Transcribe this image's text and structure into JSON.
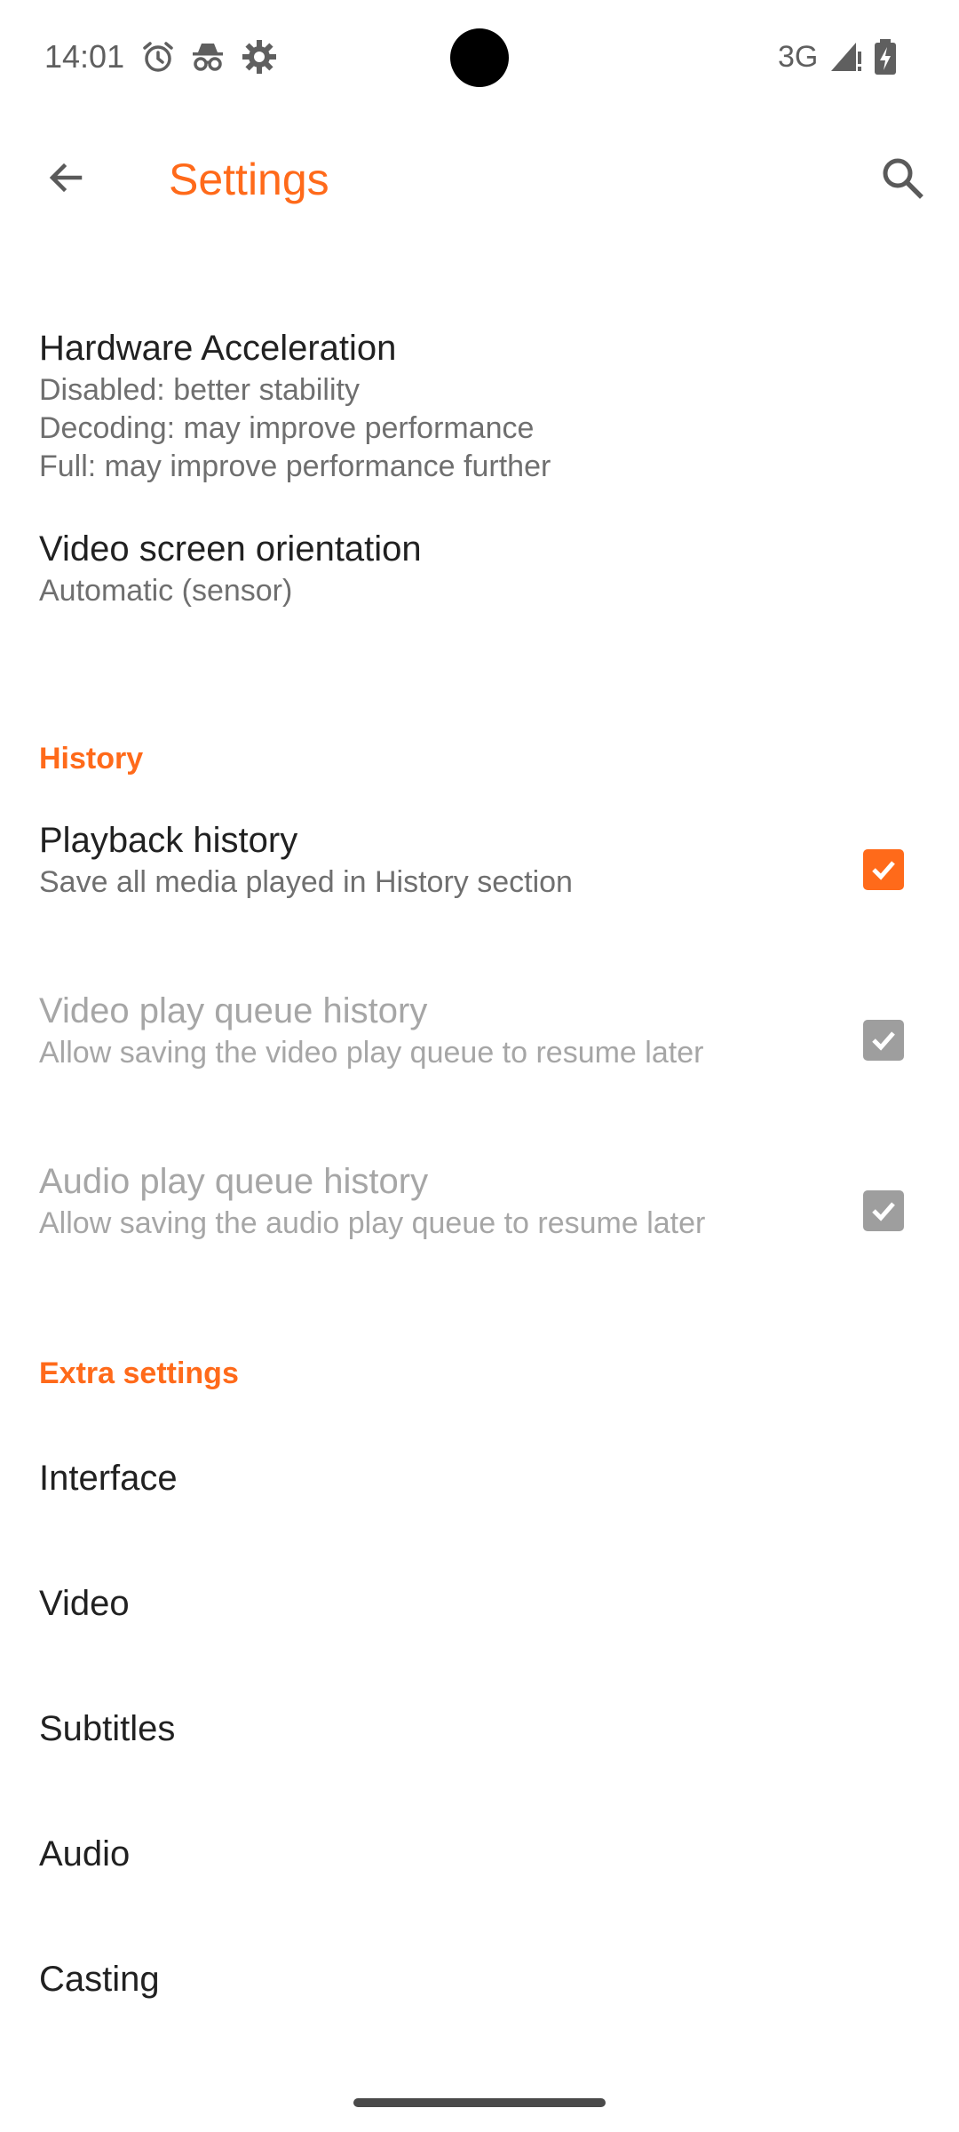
{
  "status_bar": {
    "time": "14:01",
    "network": "3G",
    "icons": [
      "alarm-icon",
      "incognito-icon",
      "settings-gear-icon",
      "signal-icon",
      "battery-charging-icon"
    ]
  },
  "app_bar": {
    "title": "Settings",
    "back_icon": "arrow-left-icon",
    "search_icon": "search-icon"
  },
  "colors": {
    "accent": "#ff6a1a",
    "text_primary": "#212121",
    "text_secondary": "#6f6f6f",
    "text_disabled": "#a6a6a6",
    "checkbox_disabled": "#9e9e9e"
  },
  "video_prefs": [
    {
      "title": "Hardware Acceleration",
      "summary_lines": [
        "Disabled: better stability",
        "Decoding: may improve performance",
        "Full: may improve performance further"
      ]
    },
    {
      "title": "Video screen orientation",
      "summary": "Automatic (sensor)"
    }
  ],
  "history_section": {
    "header": "History",
    "items": [
      {
        "title": "Playback history",
        "summary": "Save all media played in History section",
        "checked": true,
        "enabled": true
      },
      {
        "title": "Video play queue history",
        "summary": "Allow saving the video play queue to resume later",
        "checked": true,
        "enabled": false
      },
      {
        "title": "Audio play queue history",
        "summary": "Allow saving the audio play queue to resume later",
        "checked": true,
        "enabled": false
      }
    ]
  },
  "extra_section": {
    "header": "Extra settings",
    "items": [
      "Interface",
      "Video",
      "Subtitles",
      "Audio",
      "Casting"
    ]
  }
}
